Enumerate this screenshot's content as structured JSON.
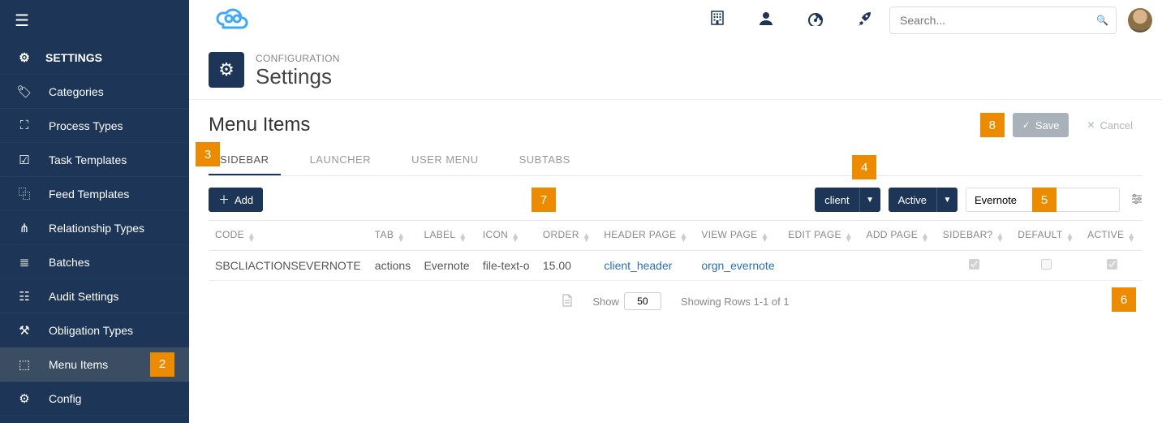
{
  "topbar": {
    "search_placeholder": "Search...",
    "icons": [
      "building",
      "user",
      "dashboard",
      "rocket"
    ]
  },
  "sidebar": {
    "header": "SETTINGS",
    "items": [
      {
        "label": "Categories",
        "icon": "tags"
      },
      {
        "label": "Process Types",
        "icon": "sitemap"
      },
      {
        "label": "Task Templates",
        "icon": "check-square"
      },
      {
        "label": "Feed Templates",
        "icon": "copy"
      },
      {
        "label": "Relationship Types",
        "icon": "share"
      },
      {
        "label": "Batches",
        "icon": "stack"
      },
      {
        "label": "Audit Settings",
        "icon": "list"
      },
      {
        "label": "Obligation Types",
        "icon": "gavel"
      },
      {
        "label": "Menu Items",
        "icon": "map",
        "active": true,
        "callout": "2"
      },
      {
        "label": "Config",
        "icon": "cog"
      }
    ]
  },
  "page": {
    "crumb": "CONFIGURATION",
    "title": "Settings",
    "section": "Menu Items",
    "save_label": "Save",
    "cancel_label": "Cancel",
    "save_callout": "8",
    "add_label": "Add"
  },
  "tabs": {
    "callout": "3",
    "items": [
      "SIDEBAR",
      "LAUNCHER",
      "USER MENU",
      "SUBTABS"
    ],
    "active": 0
  },
  "toolbar": {
    "scope_label": "client",
    "scope_callout": "4",
    "status_label": "Active",
    "filter_value": "Evernote",
    "filter_callout": "5",
    "order_callout": "7"
  },
  "table": {
    "columns": [
      "CODE",
      "TAB",
      "LABEL",
      "ICON",
      "ORDER",
      "HEADER PAGE",
      "VIEW PAGE",
      "EDIT PAGE",
      "ADD PAGE",
      "SIDEBAR?",
      "DEFAULT",
      "ACTIVE"
    ],
    "rows": [
      {
        "code": "SBCLIACTIONSEVERNOTE",
        "tab": "actions",
        "label": "Evernote",
        "icon": "file-text-o",
        "order": "15.00",
        "header_page": "client_header",
        "view_page": "orgn_evernote",
        "edit_page": "",
        "add_page": "",
        "sidebar": true,
        "default": false,
        "active": true
      }
    ]
  },
  "pager": {
    "show_label": "Show",
    "show_value": "50",
    "status": "Showing Rows 1-1 of 1",
    "callout": "6"
  }
}
